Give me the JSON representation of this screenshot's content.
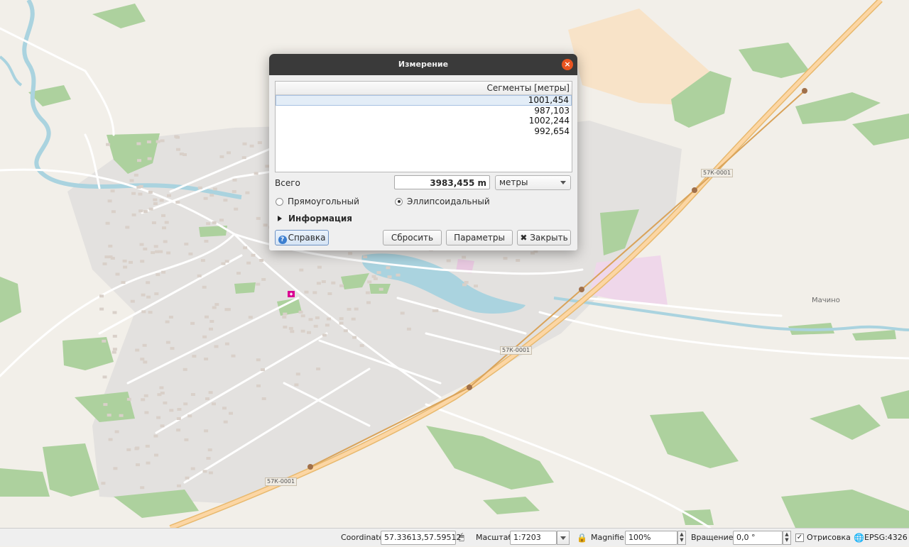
{
  "map": {
    "labels": {
      "village": "Мачино",
      "road_1": "57К-0001",
      "road_2": "57К-0001",
      "road_3": "57К-0001"
    },
    "colors": {
      "background": "#f2efe9",
      "forest": "#add19e",
      "water": "#aad3df",
      "residential": "#e0dfdf",
      "trunk_road": "#fcd6a4",
      "measure_line": "#d9a35a"
    }
  },
  "dialog": {
    "title": "Измерение",
    "close_icon": "close-icon",
    "segments_header": "Сегменты [метры]",
    "segments": [
      "1001,454",
      "987,103",
      "1002,244",
      "992,654"
    ],
    "total_label": "Всего",
    "total_value": "3983,455 m",
    "unit": "метры",
    "radio_cartesian": "Прямоугольный",
    "radio_ellipsoidal": "Эллипсоидальный",
    "selected_mode": "ellipsoidal",
    "info_label": "Информация",
    "help_button": "Справка",
    "reset_button": "Сбросить",
    "params_button": "Параметры",
    "close_button": "Закрыть"
  },
  "statusbar": {
    "coordinate_label": "Coordinate",
    "coordinate_value": "57.33613,57.59512",
    "scale_label": "Масштаб",
    "scale_value": "1:7203",
    "magnifier_label": "Magnifier",
    "magnifier_value": "100%",
    "rotation_label": "Вращение",
    "rotation_value": "0,0 °",
    "render_label": "Отрисовка",
    "render_checked": true,
    "crs_label": "EPSG:4326"
  }
}
